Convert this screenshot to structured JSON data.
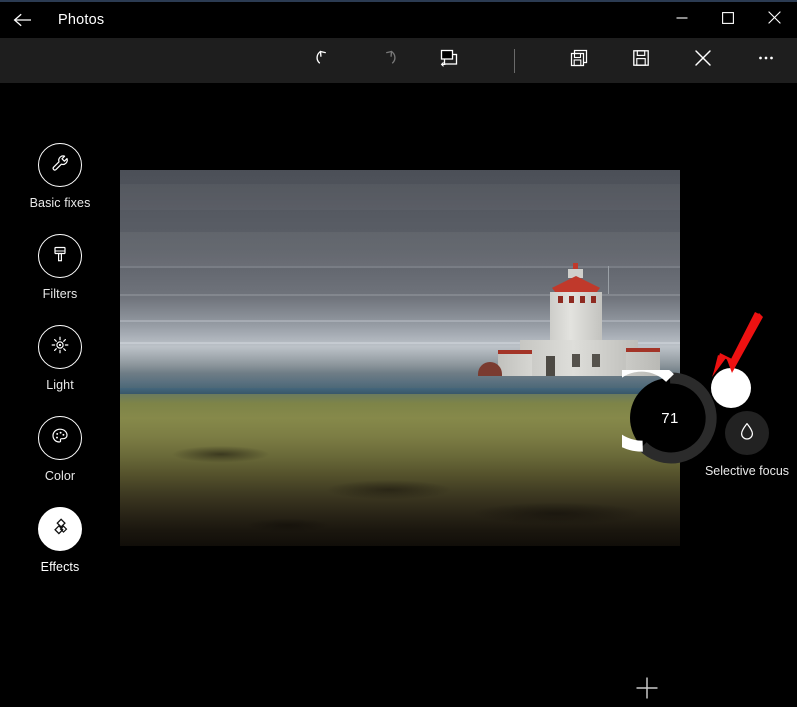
{
  "window": {
    "title": "Photos",
    "back_icon": "back-arrow-icon",
    "controls": {
      "minimize": "minimize-icon",
      "maximize": "maximize-icon",
      "close": "close-icon"
    }
  },
  "toolbar": {
    "items": [
      {
        "name": "undo",
        "icon": "undo-icon",
        "label": "Undo",
        "enabled": true
      },
      {
        "name": "redo",
        "icon": "redo-icon",
        "label": "Redo",
        "enabled": false
      },
      {
        "name": "compare",
        "icon": "compare-icon",
        "label": "Compare",
        "enabled": true
      },
      {
        "name": "save-a-copy",
        "icon": "save-copy-icon",
        "label": "Save a copy",
        "enabled": true
      },
      {
        "name": "save",
        "icon": "save-icon",
        "label": "Save",
        "enabled": true
      },
      {
        "name": "cancel",
        "icon": "close-x-icon",
        "label": "Cancel",
        "enabled": true
      },
      {
        "name": "see-more",
        "icon": "ellipsis-icon",
        "label": "See more",
        "enabled": true
      }
    ]
  },
  "sidebar": {
    "items": [
      {
        "label": "Basic fixes",
        "icon": "wrench-icon",
        "selected": false
      },
      {
        "label": "Filters",
        "icon": "paintbrush-icon",
        "selected": false
      },
      {
        "label": "Light",
        "icon": "sun-icon",
        "selected": false
      },
      {
        "label": "Color",
        "icon": "palette-icon",
        "selected": false
      },
      {
        "label": "Effects",
        "icon": "diamonds-icon",
        "selected": true
      }
    ]
  },
  "right_panel": {
    "tool": {
      "label": "Selective focus",
      "icon": "water-drop-icon"
    }
  },
  "dial": {
    "value": "71",
    "min": 0,
    "max": 100,
    "track_color": "#2b2b2b",
    "progress_color": "#ffffff",
    "handle": "dial-handle"
  },
  "annotation": {
    "arrow_color": "#ee1111",
    "points_to": "dial-handle"
  },
  "canvas": {
    "add_button_label": "+",
    "photo_alt": "lighthouse-photo"
  },
  "colors": {
    "window_background": "#000000",
    "toolbar_background": "#1e1e1e",
    "accent_line": "#2b3b52",
    "text": "#ffffff"
  }
}
